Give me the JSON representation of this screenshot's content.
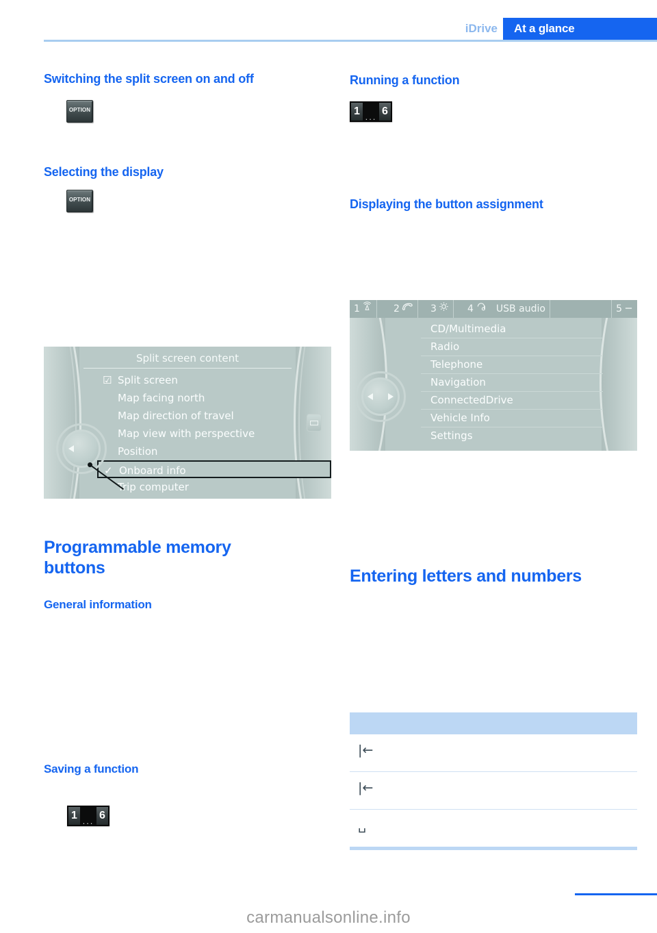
{
  "header": {
    "chapter": "iDrive",
    "section": "At a glance"
  },
  "left_column": {
    "headings": {
      "switching_split_screen": "Switching the split screen on and off",
      "selecting_display": "Selecting the display",
      "programmable_memory_buttons": "Programmable memory buttons",
      "general_information": "General information",
      "saving_a_function": "Saving a function"
    },
    "option_button_label": "OPTION",
    "memory_button": {
      "first": "1",
      "dots": "...",
      "last": "6"
    },
    "split_screen_display": {
      "title": "Split screen content",
      "items": [
        {
          "label": "Split screen",
          "check": "☑",
          "highlight": false
        },
        {
          "label": "Map facing north",
          "check": "",
          "highlight": false
        },
        {
          "label": "Map direction of travel",
          "check": "",
          "highlight": false
        },
        {
          "label": "Map view with perspective",
          "check": "",
          "highlight": false
        },
        {
          "label": "Position",
          "check": "",
          "highlight": false
        },
        {
          "label": "Onboard info",
          "check": "✓",
          "highlight": true
        },
        {
          "label": "Trip computer",
          "check": "",
          "highlight": false
        }
      ]
    }
  },
  "right_column": {
    "headings": {
      "running_a_function": "Running a function",
      "displaying_button_assignment": "Displaying the button assignment",
      "entering_letters_and_numbers": "Entering letters and numbers"
    },
    "memory_button": {
      "first": "1",
      "dots": "...",
      "last": "6"
    },
    "button_assignment_display": {
      "status_bar": [
        {
          "number": "1",
          "icon": "radio-waves-icon",
          "text": ""
        },
        {
          "number": "2",
          "icon": "telephone-icon",
          "text": ""
        },
        {
          "number": "3",
          "icon": "gear-icon",
          "text": ""
        },
        {
          "number": "4",
          "icon": "music-note-icon",
          "text": "USB audio"
        },
        {
          "number": "5",
          "icon": "dash-icon",
          "text": ""
        }
      ],
      "items": [
        "CD/Multimedia",
        "Radio",
        "Telephone",
        "Navigation",
        "ConnectedDrive",
        "Vehicle Info",
        "Settings"
      ]
    },
    "symbol_table": {
      "rows": [
        {
          "symbol": "|←",
          "name": "backspace-icon"
        },
        {
          "symbol": "|←",
          "name": "backspace-icon"
        },
        {
          "symbol": "␣",
          "name": "space-bar-icon"
        }
      ]
    }
  },
  "footer": {
    "watermark": "carmanualsonline.info"
  },
  "colors": {
    "accent_blue": "#1565f0",
    "light_blue": "#8cb8ee",
    "rule_blue": "#a8cdf0",
    "table_header_blue": "#bcd7f4",
    "screen_gray": "#b9c9c7"
  }
}
